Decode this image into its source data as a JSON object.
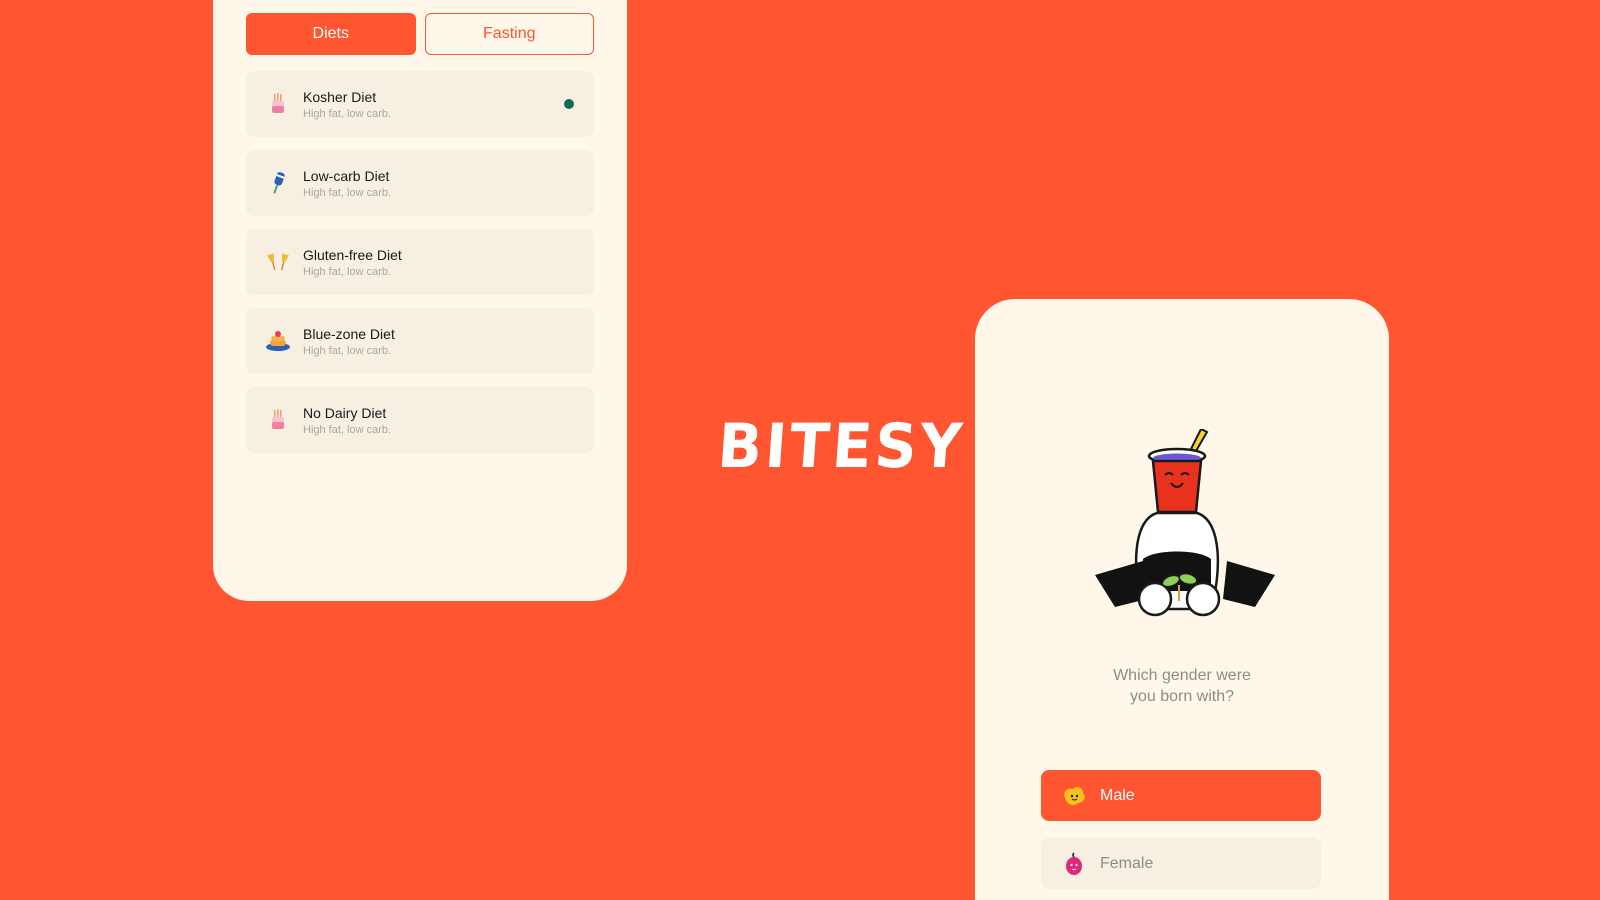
{
  "tabs": [
    {
      "label": "Diets",
      "active": true
    },
    {
      "label": "Fasting",
      "active": false
    }
  ],
  "diets": [
    {
      "title": "Kosher Diet",
      "subtitle": "High fat, low carb.",
      "icon": "cake-icon",
      "selected": true
    },
    {
      "title": "Low-carb Diet",
      "subtitle": "High fat, low carb.",
      "icon": "popsicle-icon",
      "selected": false
    },
    {
      "title": "Gluten-free Diet",
      "subtitle": "High fat, low carb.",
      "icon": "glasses-icon",
      "selected": false
    },
    {
      "title": "Blue-zone Diet",
      "subtitle": "High fat, low carb.",
      "icon": "pancakes-icon",
      "selected": false
    },
    {
      "title": "No Dairy Diet",
      "subtitle": "High fat, low carb.",
      "icon": "cake-icon",
      "selected": false
    }
  ],
  "logo": "BITESY",
  "question": {
    "line1": "Which gender were",
    "line2": "you born with?"
  },
  "gender_options": [
    {
      "label": "Male",
      "selected": true,
      "icon": "yellow-blob-icon"
    },
    {
      "label": "Female",
      "selected": false,
      "icon": "pink-berry-icon"
    }
  ],
  "colors": {
    "accent": "#FF5530",
    "card_bg": "#FFF8EA",
    "item_bg": "#F7EFE2",
    "selected_dot": "#0E6B5A"
  }
}
